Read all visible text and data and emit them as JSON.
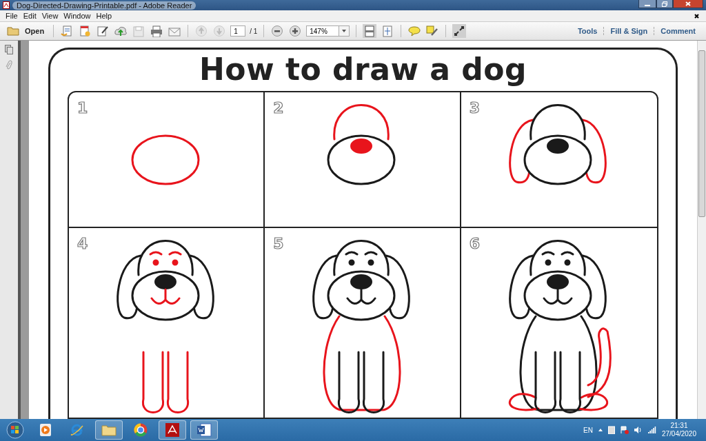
{
  "window": {
    "title": "Dog-Directed-Drawing-Printable.pdf - Adobe Reader"
  },
  "menu": [
    "File",
    "Edit",
    "View",
    "Window",
    "Help"
  ],
  "toolbar": {
    "open": "Open",
    "page": "1",
    "page_total": "/ 1",
    "zoom": "147%",
    "panels": [
      "Tools",
      "Fill & Sign",
      "Comment"
    ]
  },
  "document": {
    "title": "How to draw a dog",
    "steps": [
      {
        "number": "1"
      },
      {
        "number": "2"
      },
      {
        "number": "3"
      },
      {
        "number": "4"
      },
      {
        "number": "5"
      },
      {
        "number": "6"
      }
    ]
  },
  "taskbar": {
    "language": "EN",
    "time": "21:31",
    "date": "27/04/2020"
  }
}
